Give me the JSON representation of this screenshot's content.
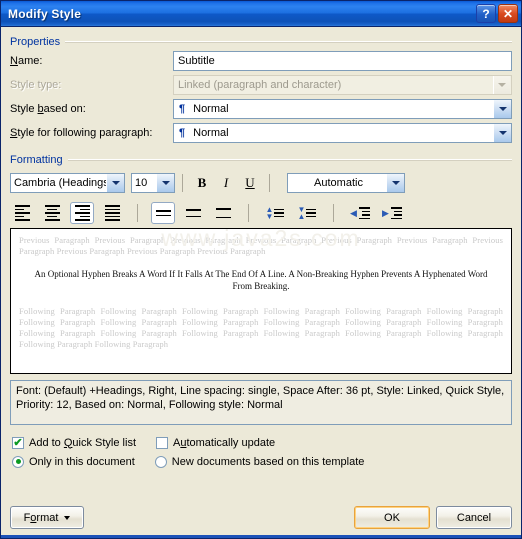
{
  "window": {
    "title": "Modify Style",
    "help_icon": "question-mark-icon",
    "close_icon": "close-x-icon"
  },
  "properties": {
    "group_label": "Properties",
    "fields": [
      {
        "label": "Name:",
        "label_accel": "N",
        "value": "Subtitle",
        "type": "text",
        "disabled": false,
        "has_pilcrow": false
      },
      {
        "label": "Style type:",
        "label_accel": "",
        "value": "Linked (paragraph and character)",
        "type": "combo",
        "disabled": true,
        "has_pilcrow": false
      },
      {
        "label": "Style based on:",
        "label_accel": "b",
        "value": "Normal",
        "type": "combo",
        "disabled": false,
        "has_pilcrow": true
      },
      {
        "label": "Style for following paragraph:",
        "label_accel": "S",
        "value": "Normal",
        "type": "combo",
        "disabled": false,
        "has_pilcrow": true
      }
    ]
  },
  "formatting": {
    "group_label": "Formatting",
    "font_name": "Cambria (Headings)",
    "font_size": "10",
    "font_color": "Automatic",
    "bold_label": "B",
    "italic_label": "I",
    "underline_label": "U",
    "bold_active": false,
    "italic_active": false,
    "underline_active": false,
    "alignment_active": "align-right",
    "line_spacing_active": "single",
    "buttons": [
      {
        "name": "align-left-button",
        "active": false
      },
      {
        "name": "align-center-button",
        "active": false
      },
      {
        "name": "align-right-button",
        "active": true
      },
      {
        "name": "align-justify-button",
        "active": false
      },
      {
        "name": "line-spacing-single-button",
        "active": true
      },
      {
        "name": "line-spacing-1half-button",
        "active": false
      },
      {
        "name": "line-spacing-double-button",
        "active": false
      },
      {
        "name": "decrease-spacing-button",
        "active": false
      },
      {
        "name": "increase-spacing-button",
        "active": false
      },
      {
        "name": "decrease-indent-button",
        "active": false
      },
      {
        "name": "increase-indent-button",
        "active": false
      }
    ]
  },
  "preview": {
    "watermark": "www.java2s.com",
    "previous_paragraph": "Previous Paragraph Previous Paragraph Previous Paragraph Previous Paragraph Previous Paragraph Previous Paragraph Previous Paragraph Previous Paragraph Previous Paragraph Previous Paragraph",
    "sample_text": "An Optional Hyphen Breaks A Word If It Falls At The End Of A Line. A Non-Breaking Hyphen Prevents A Hyphenated Word From Breaking.",
    "following_paragraph": "Following Paragraph Following Paragraph Following Paragraph Following Paragraph Following Paragraph Following Paragraph Following Paragraph Following Paragraph Following Paragraph Following Paragraph Following Paragraph Following Paragraph Following Paragraph Following Paragraph Following Paragraph Following Paragraph Following Paragraph Following Paragraph Following Paragraph Following Paragraph"
  },
  "description": "Font: (Default) +Headings, Right, Line spacing:  single, Space After:  36 pt, Style: Linked, Quick Style, Priority: 12, Based on: Normal, Following style: Normal",
  "options": {
    "add_to_quick_style": {
      "label": "Add to Quick Style list",
      "checked": true
    },
    "automatically_update": {
      "label": "Automatically update",
      "checked": false
    },
    "only_in_this_document": {
      "label": "Only in this document",
      "selected": true
    },
    "new_documents_based_on_template": {
      "label": "New documents based on this template",
      "selected": false
    }
  },
  "footer": {
    "format_label": "Format",
    "ok_label": "OK",
    "cancel_label": "Cancel"
  },
  "colors": {
    "dialog_background": "#ECE9D8",
    "title_blue": "#0E59C8",
    "group_label_blue": "#0033A0",
    "check_green": "#0B9A22",
    "default_button_gold": "#E8A33D"
  }
}
